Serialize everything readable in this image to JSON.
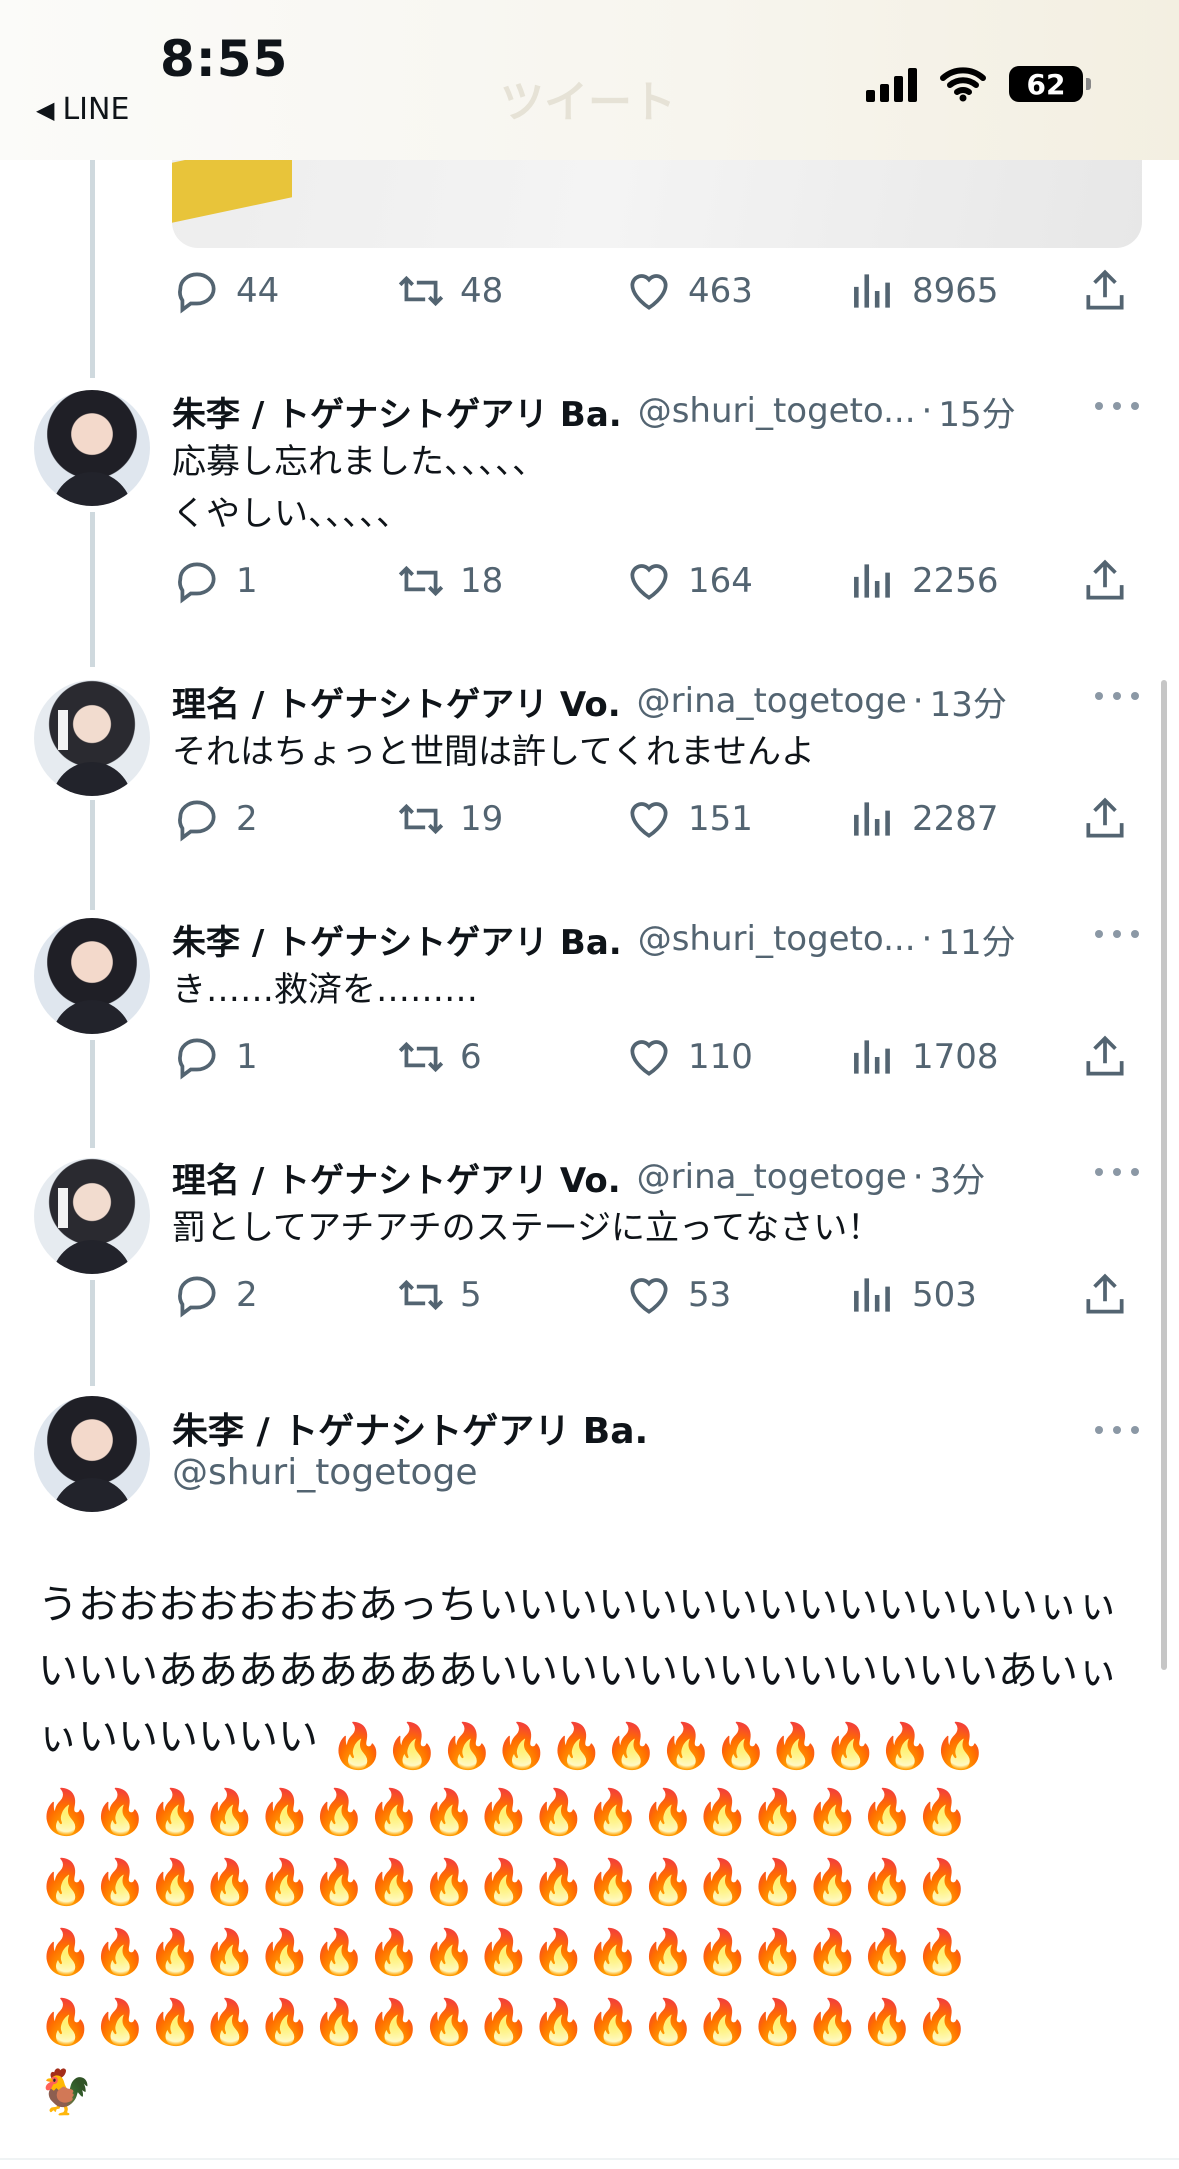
{
  "status_bar": {
    "time": "8:55",
    "back_app": "LINE",
    "back_glyph": "◀",
    "ghost_title": "ツイート",
    "battery": "62"
  },
  "first_tweet_actions": {
    "reply": "44",
    "retweet": "48",
    "like": "463",
    "views": "8965"
  },
  "replies": [
    {
      "name": "朱李 / トゲナシトゲアリ Ba.",
      "handle": "@shuri_togeto...",
      "time": "15分",
      "text_lines": [
        "応募し忘れました、、、、、",
        "くやしい、、、、、"
      ],
      "reply": "1",
      "retweet": "18",
      "like": "164",
      "views": "2256"
    },
    {
      "name": "理名 / トゲナシトゲアリ Vo.",
      "handle": "@rina_togetoge",
      "time": "13分",
      "text_lines": [
        "それはちょっと世間は許してくれませんよ"
      ],
      "reply": "2",
      "retweet": "19",
      "like": "151",
      "views": "2287"
    },
    {
      "name": "朱李 / トゲナシトゲアリ Ba.",
      "handle": "@shuri_togeto...",
      "time": "11分",
      "text_lines": [
        "き……救済を………"
      ],
      "reply": "1",
      "retweet": "6",
      "like": "110",
      "views": "1708"
    },
    {
      "name": "理名 / トゲナシトゲアリ Vo.",
      "handle": "@rina_togetoge",
      "time": "3分",
      "text_lines": [
        "罰としてアチアチのステージに立ってなさい！"
      ],
      "reply": "2",
      "retweet": "5",
      "like": "53",
      "views": "503"
    }
  ],
  "main_tweet": {
    "name": "朱李 / トゲナシトゲアリ Ba.",
    "handle": "@shuri_togetoge",
    "text": "うおおおおおおおあっちいいいいいいいいいいいいいいぃぃいいいああああああああいいいいいいいいいいいいいあいぃぃいいいいいい",
    "fire_line_1": "🔥🔥🔥🔥🔥🔥🔥🔥🔥🔥🔥🔥",
    "fire_row": "🔥🔥🔥🔥🔥🔥🔥🔥🔥🔥🔥🔥🔥🔥🔥🔥🔥",
    "chicken": "🐓"
  }
}
